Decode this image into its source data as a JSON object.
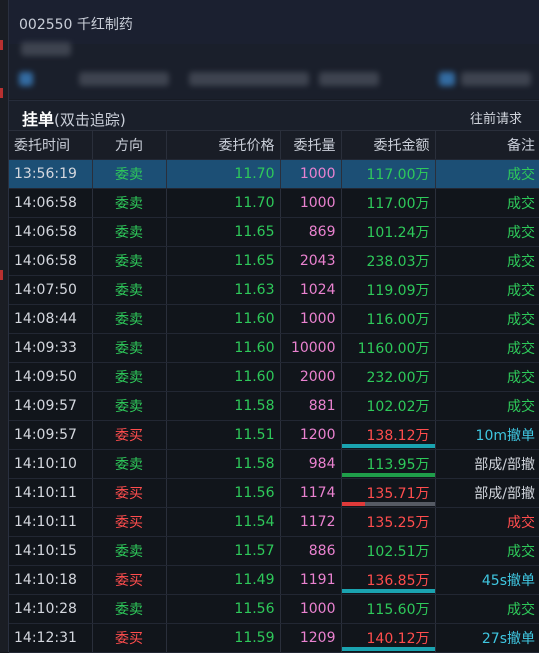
{
  "window": {
    "title": "002550 千红制药"
  },
  "panel": {
    "title": "挂单",
    "subtitle": "(双击追踪)",
    "action": "往前请求"
  },
  "columns": [
    "委托时间",
    "方向",
    "委托价格",
    "委托量",
    "委托金额",
    "备注"
  ],
  "colors": {
    "buy": "#ff4d4d",
    "sell": "#2ec95a",
    "volume": "#ea82d0",
    "cancel": "#3fc6e0",
    "selected": "#1c4f75",
    "bar_teal": "#1aa3b0",
    "bar_green": "#1f9e4a",
    "bar_red": "#e03a3a",
    "bar_gray": "#555a64"
  },
  "rows": [
    {
      "time": "13:56:19",
      "dir": "委卖",
      "side": "sell",
      "price": "11.70",
      "volume": "1000",
      "amount": "117.00万",
      "remark": "成交",
      "remark_type": "deal",
      "selected": true
    },
    {
      "time": "14:06:58",
      "dir": "委卖",
      "side": "sell",
      "price": "11.70",
      "volume": "1000",
      "amount": "117.00万",
      "remark": "成交",
      "remark_type": "deal"
    },
    {
      "time": "14:06:58",
      "dir": "委卖",
      "side": "sell",
      "price": "11.65",
      "volume": "869",
      "amount": "101.24万",
      "remark": "成交",
      "remark_type": "deal"
    },
    {
      "time": "14:06:58",
      "dir": "委卖",
      "side": "sell",
      "price": "11.65",
      "volume": "2043",
      "amount": "238.03万",
      "remark": "成交",
      "remark_type": "deal"
    },
    {
      "time": "14:07:50",
      "dir": "委卖",
      "side": "sell",
      "price": "11.63",
      "volume": "1024",
      "amount": "119.09万",
      "remark": "成交",
      "remark_type": "deal"
    },
    {
      "time": "14:08:44",
      "dir": "委卖",
      "side": "sell",
      "price": "11.60",
      "volume": "1000",
      "amount": "116.00万",
      "remark": "成交",
      "remark_type": "deal"
    },
    {
      "time": "14:09:33",
      "dir": "委卖",
      "side": "sell",
      "price": "11.60",
      "volume": "10000",
      "amount": "1160.00万",
      "remark": "成交",
      "remark_type": "deal"
    },
    {
      "time": "14:09:50",
      "dir": "委卖",
      "side": "sell",
      "price": "11.60",
      "volume": "2000",
      "amount": "232.00万",
      "remark": "成交",
      "remark_type": "deal"
    },
    {
      "time": "14:09:57",
      "dir": "委卖",
      "side": "sell",
      "price": "11.58",
      "volume": "881",
      "amount": "102.02万",
      "remark": "成交",
      "remark_type": "deal"
    },
    {
      "time": "14:09:57",
      "dir": "委买",
      "side": "buy",
      "price": "11.51",
      "volume": "1200",
      "amount": "138.12万",
      "remark": "10m撤单",
      "remark_type": "cancel",
      "bar": "teal",
      "bar_fill": 1.0
    },
    {
      "time": "14:10:10",
      "dir": "委卖",
      "side": "sell",
      "price": "11.58",
      "volume": "984",
      "amount": "113.95万",
      "remark": "部成/部撤",
      "remark_type": "partial",
      "bar": "green",
      "bar_fill": 1.0
    },
    {
      "time": "14:10:11",
      "dir": "委买",
      "side": "buy",
      "price": "11.56",
      "volume": "1174",
      "amount": "135.71万",
      "remark": "部成/部撤",
      "remark_type": "partial",
      "bar": "redgray",
      "bar_fill": 0.25
    },
    {
      "time": "14:10:11",
      "dir": "委买",
      "side": "buy",
      "price": "11.54",
      "volume": "1172",
      "amount": "135.25万",
      "remark": "成交",
      "remark_type": "deal_red"
    },
    {
      "time": "14:10:15",
      "dir": "委卖",
      "side": "sell",
      "price": "11.57",
      "volume": "886",
      "amount": "102.51万",
      "remark": "成交",
      "remark_type": "deal"
    },
    {
      "time": "14:10:18",
      "dir": "委买",
      "side": "buy",
      "price": "11.49",
      "volume": "1191",
      "amount": "136.85万",
      "remark": "45s撤单",
      "remark_type": "cancel",
      "bar": "teal",
      "bar_fill": 1.0
    },
    {
      "time": "14:10:28",
      "dir": "委卖",
      "side": "sell",
      "price": "11.56",
      "volume": "1000",
      "amount": "115.60万",
      "remark": "成交",
      "remark_type": "deal"
    },
    {
      "time": "14:12:31",
      "dir": "委买",
      "side": "buy",
      "price": "11.59",
      "volume": "1209",
      "amount": "140.12万",
      "remark": "27s撤单",
      "remark_type": "cancel",
      "bar": "teal",
      "bar_fill": 1.0
    }
  ]
}
